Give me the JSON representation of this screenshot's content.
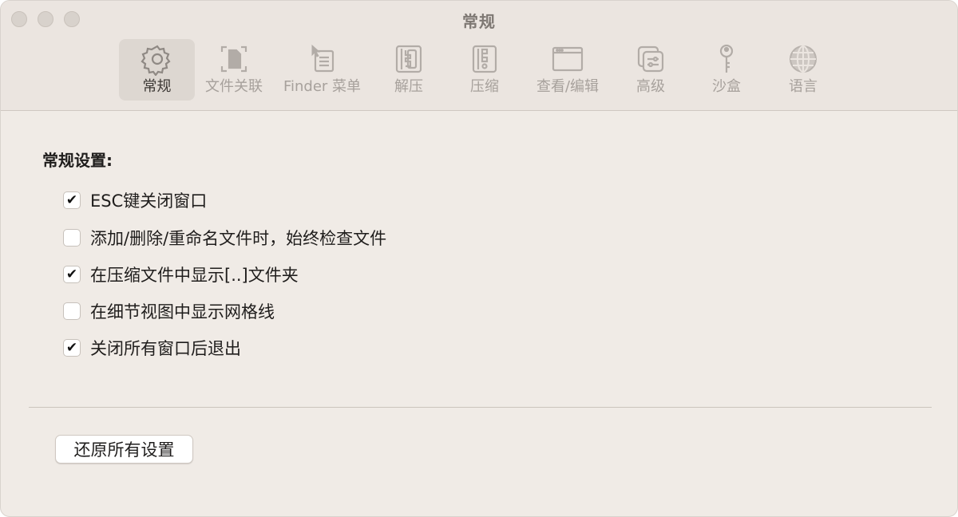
{
  "window": {
    "title": "常规"
  },
  "toolbar": {
    "items": [
      {
        "label": "常规",
        "icon": "gear-icon",
        "active": true
      },
      {
        "label": "文件关联",
        "icon": "file-association-icon",
        "active": false
      },
      {
        "label": "Finder 菜单",
        "icon": "finder-menu-icon",
        "active": false
      },
      {
        "label": "解压",
        "icon": "extract-icon",
        "active": false
      },
      {
        "label": "压缩",
        "icon": "compress-icon",
        "active": false
      },
      {
        "label": "查看/编辑",
        "icon": "view-edit-icon",
        "active": false
      },
      {
        "label": "高级",
        "icon": "advanced-icon",
        "active": false
      },
      {
        "label": "沙盒",
        "icon": "key-icon",
        "active": false
      },
      {
        "label": "语言",
        "icon": "globe-icon",
        "active": false
      }
    ]
  },
  "general": {
    "section_title": "常规设置:",
    "options": [
      {
        "label": "ESC键关闭窗口",
        "checked": true
      },
      {
        "label": "添加/删除/重命名文件时，始终检查文件",
        "checked": false
      },
      {
        "label": "在压缩文件中显示[..]文件夹",
        "checked": true
      },
      {
        "label": "在细节视图中显示网格线",
        "checked": false
      },
      {
        "label": "关闭所有窗口后退出",
        "checked": true
      }
    ],
    "check_glyph": "✔"
  },
  "footer": {
    "reset_label": "还原所有设置"
  },
  "colors": {
    "background": "#f0ebe6",
    "toolbar": "#ebe5e0",
    "active_tab": "#ddd7d1"
  }
}
